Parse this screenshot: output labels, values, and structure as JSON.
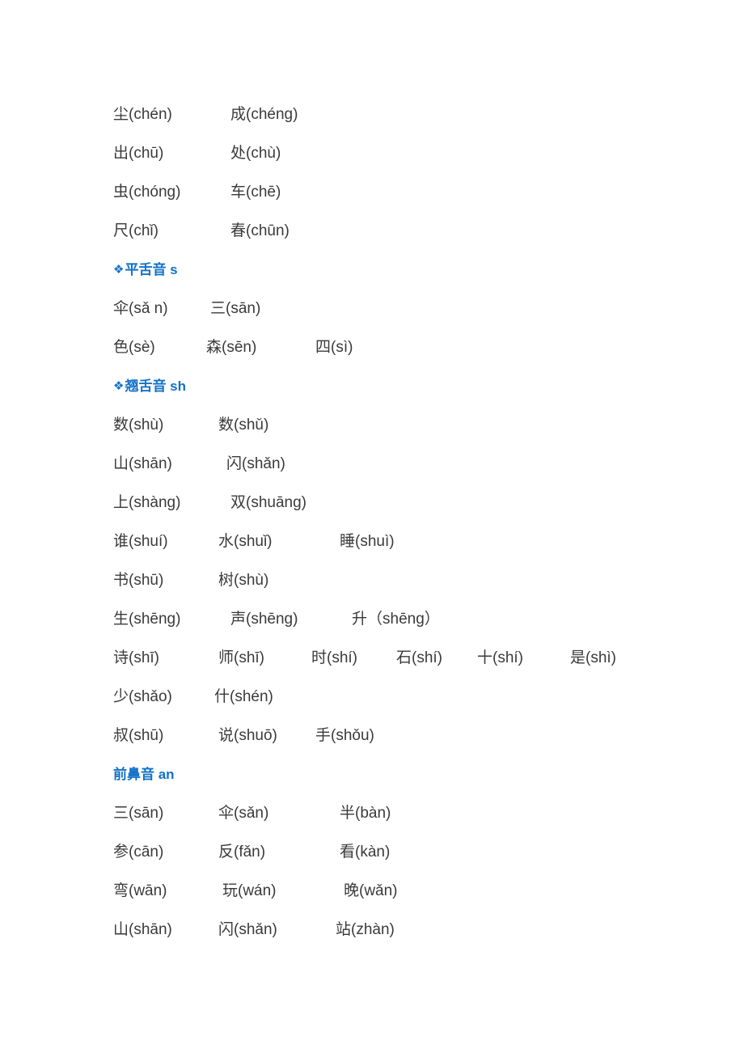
{
  "document": {
    "background_color": "#ffffff",
    "text_color": "#3a3a3a",
    "accent_color": "#1272c8",
    "bullet_glyph": "❖"
  },
  "blocks": [
    {
      "kind": "row",
      "name": "word-row-chen-cheng",
      "words": [
        "尘(chén)",
        "成(chéng)"
      ]
    },
    {
      "kind": "row",
      "name": "word-row-chu",
      "words": [
        "出(chū)",
        "处(chù)"
      ]
    },
    {
      "kind": "row",
      "name": "word-row-chong-che",
      "words": [
        "虫(chóng)",
        "车(chē)"
      ]
    },
    {
      "kind": "row",
      "name": "word-row-chi-chun",
      "words": [
        "尺(chǐ)",
        "春(chūn)"
      ]
    },
    {
      "kind": "head",
      "name": "section-header-pingsheyin-s",
      "bullet": "❖",
      "text": "平舌音 s"
    },
    {
      "kind": "row",
      "name": "word-row-san-san",
      "words": [
        "伞(sǎ n)",
        "三(sān)"
      ]
    },
    {
      "kind": "row",
      "name": "word-row-se-sen-si",
      "words": [
        "色(sè)",
        "森(sēn)",
        "四(sì)"
      ]
    },
    {
      "kind": "head",
      "name": "section-header-qiaosheyin-sh",
      "bullet": "❖",
      "text": "翘舌音 sh"
    },
    {
      "kind": "row",
      "name": "word-row-shu-shu",
      "words": [
        "数(shù)",
        "数(shǔ)"
      ]
    },
    {
      "kind": "row",
      "name": "word-row-shan-shan",
      "words": [
        "山(shān)",
        "闪(shǎn)"
      ]
    },
    {
      "kind": "row",
      "name": "word-row-shang-shuang",
      "words": [
        "上(shàng)",
        "双(shuāng)"
      ]
    },
    {
      "kind": "row",
      "name": "word-row-shui",
      "words": [
        "谁(shuí)",
        "水(shuǐ)",
        "睡(shuì)"
      ]
    },
    {
      "kind": "row",
      "name": "word-row-shu-shu2",
      "words": [
        "书(shū)",
        "树(shù)"
      ]
    },
    {
      "kind": "row",
      "name": "word-row-sheng",
      "words": [
        "生(shēng)",
        "声(shēng)",
        "升（shēng）"
      ]
    },
    {
      "kind": "row",
      "name": "word-row-shi",
      "words": [
        "诗(shī)",
        "师(shī)",
        "时(shí)",
        "石(shí)",
        "十(shí)",
        "是(shì)"
      ]
    },
    {
      "kind": "row",
      "name": "word-row-shao-shen",
      "words": [
        "少(shǎo)",
        "什(shén)"
      ]
    },
    {
      "kind": "row",
      "name": "word-row-shu-shuo-shou",
      "words": [
        "叔(shū)",
        "说(shuō)",
        "手(shǒu)"
      ]
    },
    {
      "kind": "head",
      "name": "section-header-qianbiyin-an",
      "bullet": "",
      "text": "前鼻音 an"
    },
    {
      "kind": "row",
      "name": "word-row-san-san-ban",
      "words": [
        "三(sān)",
        "伞(sǎn)",
        "半(bàn)"
      ]
    },
    {
      "kind": "row",
      "name": "word-row-can-fan-kan",
      "words": [
        "参(cān)",
        "反(fǎn)",
        "看(kàn)"
      ]
    },
    {
      "kind": "row",
      "name": "word-row-wan-wan-wan",
      "words": [
        "弯(wān)",
        "玩(wán)",
        "晚(wǎn)"
      ]
    },
    {
      "kind": "row",
      "name": "word-row-shan-shan-zhan",
      "words": [
        "山(shān)",
        "闪(shǎn)",
        "站(zhàn)"
      ]
    }
  ]
}
